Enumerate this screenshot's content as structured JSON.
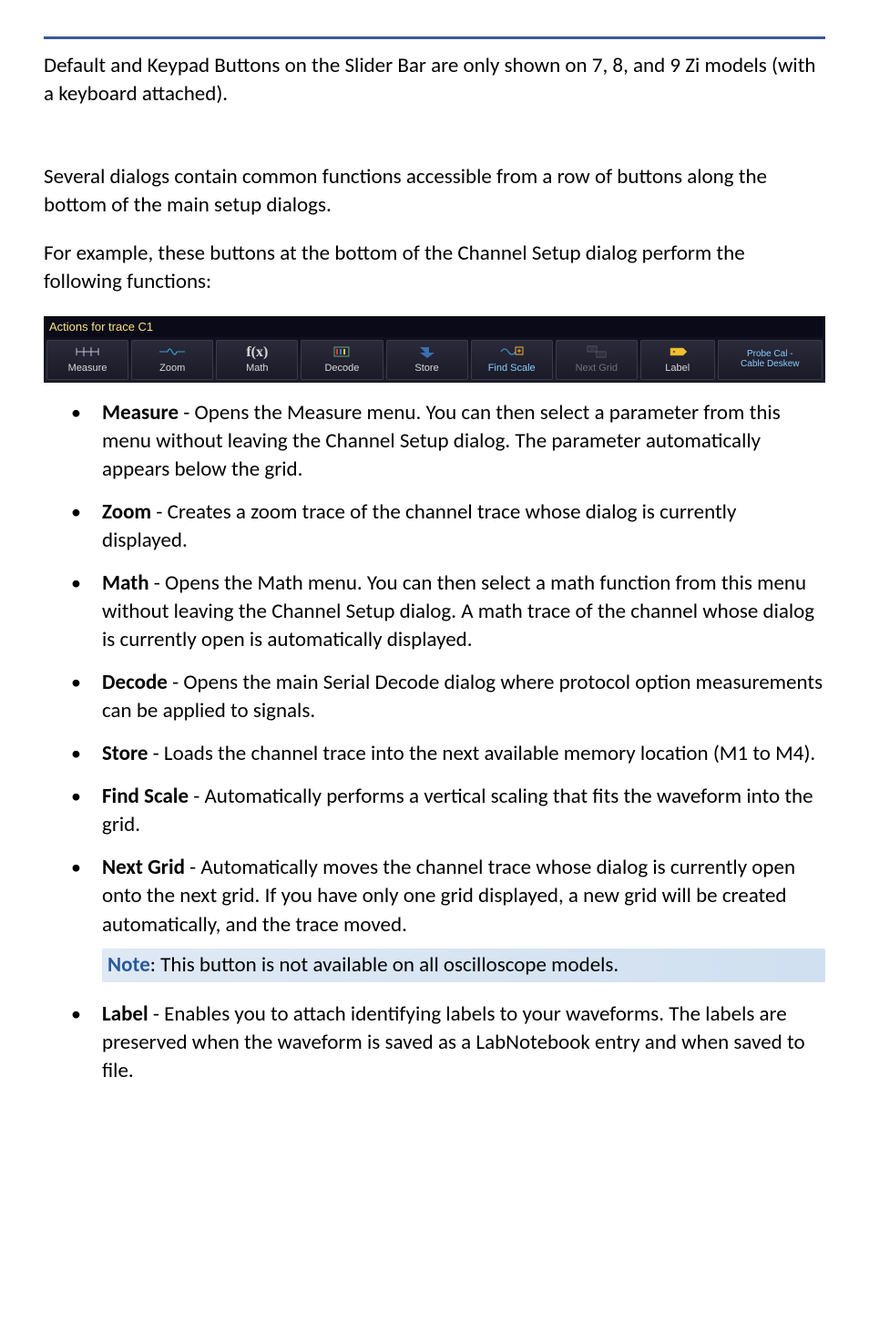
{
  "paragraphs": {
    "p1": "Default and Keypad Buttons on the Slider Bar are only shown on 7, 8, and 9 Zi models (with a keyboard attached).",
    "p2": "Several dialogs contain common functions accessible from a row of buttons along the bottom of the main setup dialogs.",
    "p3": "For example, these buttons at the bottom of the Channel Setup dialog perform the following functions:"
  },
  "toolbar": {
    "title": "Actions for trace C1",
    "buttons": {
      "measure": "Measure",
      "zoom": "Zoom",
      "math_symbol": "f(x)",
      "math": "Math",
      "decode": "Decode",
      "store": "Store",
      "findscale": "Find Scale",
      "nextgrid": "Next Grid",
      "label": "Label",
      "probecal_line1": "Probe Cal -",
      "probecal_line2": "Cable Deskew"
    }
  },
  "items": {
    "measure": {
      "term": "Measure",
      "desc": " - Opens the Measure menu. You can then select a parameter from this menu without leaving the Channel Setup dialog. The parameter automatically appears below the grid."
    },
    "zoom": {
      "term": "Zoom",
      "desc": " - Creates a zoom trace of the channel trace whose dialog is currently displayed."
    },
    "math": {
      "term": "Math",
      "desc": " - Opens the Math menu. You can then select a math function from this menu without leaving the Channel Setup dialog. A math trace of the channel whose dialog is currently open is automatically displayed."
    },
    "decode": {
      "term": "Decode",
      "desc": " - Opens the main Serial Decode dialog where protocol option measurements can be applied to signals."
    },
    "store": {
      "term": "Store",
      "desc": " - Loads the channel trace into the next available memory location (M1 to M4)."
    },
    "findscale": {
      "term": "Find Scale",
      "desc": " - Automatically performs a vertical scaling that fits the waveform into the grid."
    },
    "nextgrid": {
      "term": "Next Grid",
      "desc": " - Automatically moves the channel trace whose dialog is currently open onto the next grid. If you have only one grid displayed, a new grid will be created automatically, and the trace moved."
    },
    "label": {
      "term": "Label",
      "desc": " - Enables you to attach identifying labels to your waveforms. The labels are preserved when the waveform is saved as a LabNotebook entry and when saved to file."
    }
  },
  "note": {
    "label": "Note",
    "text": ": This button is not available on all oscilloscope models."
  }
}
